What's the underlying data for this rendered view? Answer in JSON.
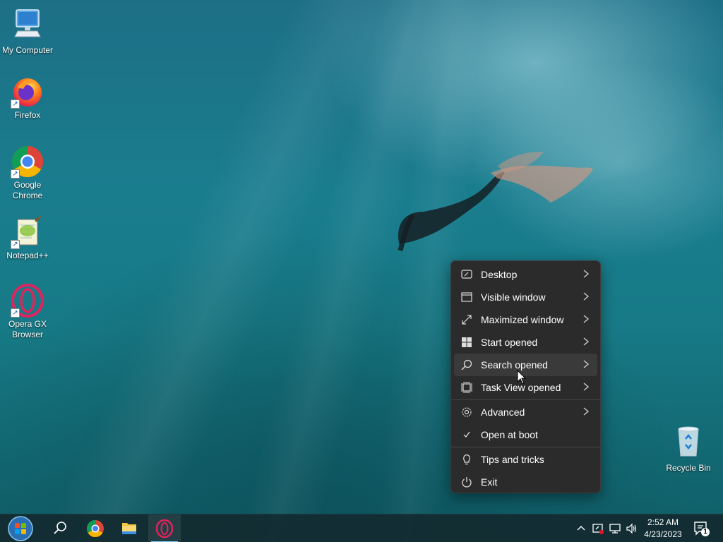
{
  "desktop": {
    "icons": [
      {
        "label": "My Computer"
      },
      {
        "label": "Firefox"
      },
      {
        "label": "Google Chrome"
      },
      {
        "label": "Notepad++"
      },
      {
        "label": "Opera GX Browser"
      },
      {
        "label": "Recycle Bin"
      }
    ]
  },
  "menu": {
    "items": [
      {
        "label": "Desktop",
        "icon": "desktop-icon",
        "submenu": true
      },
      {
        "label": "Visible window",
        "icon": "window-icon",
        "submenu": true
      },
      {
        "label": "Maximized window",
        "icon": "maximize-icon",
        "submenu": true
      },
      {
        "label": "Start opened",
        "icon": "windows-logo-icon",
        "submenu": true
      },
      {
        "label": "Search opened",
        "icon": "search-icon",
        "submenu": true,
        "hovered": true
      },
      {
        "label": "Task View opened",
        "icon": "task-view-icon",
        "submenu": true
      },
      {
        "label": "Advanced",
        "icon": "gear-icon",
        "submenu": true
      },
      {
        "label": "Open at boot",
        "icon": "check-icon",
        "checked": true
      },
      {
        "label": "Tips and tricks",
        "icon": "lightbulb-icon"
      },
      {
        "label": "Exit",
        "icon": "power-icon"
      }
    ]
  },
  "taskbar": {
    "clock": {
      "time": "2:52 AM",
      "date": "4/23/2023"
    },
    "notification_count": "1",
    "pinned": [
      "start-button",
      "search-button",
      "chrome",
      "file-explorer",
      "opera-gx"
    ]
  },
  "colors": {
    "menu_bg": "#2b2b2b",
    "menu_hover": "#3a3a3a",
    "taskbar_active": "#7fd0ff"
  }
}
